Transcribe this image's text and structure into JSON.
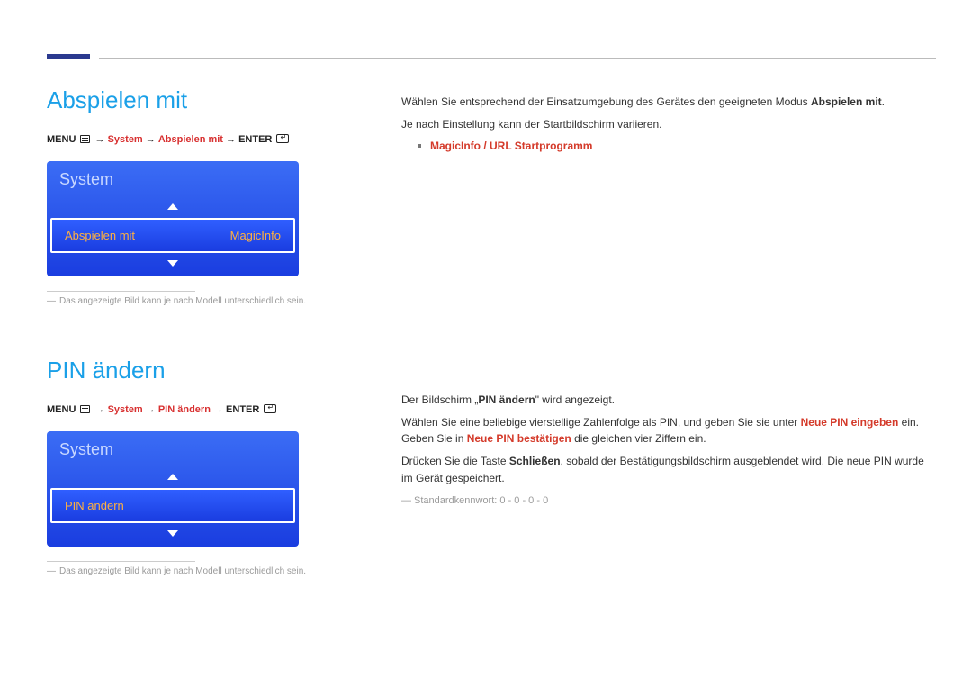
{
  "section1": {
    "title": "Abspielen mit",
    "path": {
      "menu": "MENU",
      "sep": " → ",
      "sys": "System",
      "item": "Abspielen mit",
      "enter": "ENTER"
    },
    "panel": {
      "header": "System",
      "row_label": "Abspielen mit",
      "row_value": "MagicInfo"
    },
    "footnote": "Das angezeigte Bild kann je nach Modell unterschiedlich sein.",
    "right": {
      "p1_pre": "Wählen Sie entsprechend der Einsatzumgebung des Gerätes den geeigneten Modus ",
      "p1_bold": "Abspielen mit",
      "p1_post": ".",
      "p2": "Je nach Einstellung kann der Startbildschirm variieren.",
      "bullet": "MagicInfo / URL Startprogramm"
    }
  },
  "section2": {
    "title": "PIN ändern",
    "path": {
      "menu": "MENU",
      "sep": " → ",
      "sys": "System",
      "item": "PIN ändern",
      "enter": "ENTER"
    },
    "panel": {
      "header": "System",
      "row_label": "PIN ändern"
    },
    "footnote": "Das angezeigte Bild kann je nach Modell unterschiedlich sein.",
    "right": {
      "p1_pre": "Der Bildschirm „",
      "p1_bold": "PIN ändern",
      "p1_post": "\" wird angezeigt.",
      "p2_pre": "Wählen Sie eine beliebige vierstellige Zahlenfolge als PIN, und geben Sie sie unter ",
      "p2_r1": "Neue PIN eingeben",
      "p2_mid": " ein. Geben Sie in ",
      "p2_r2": "Neue PIN bestätigen",
      "p2_post": " die gleichen vier Ziffern ein.",
      "p3_pre": "Drücken Sie die Taste ",
      "p3_bold": "Schließen",
      "p3_post": ", sobald der Bestätigungsbildschirm ausgeblendet wird. Die neue PIN wurde im Gerät gespeichert.",
      "gray": "Standardkennwort: 0 - 0 - 0 - 0"
    }
  }
}
